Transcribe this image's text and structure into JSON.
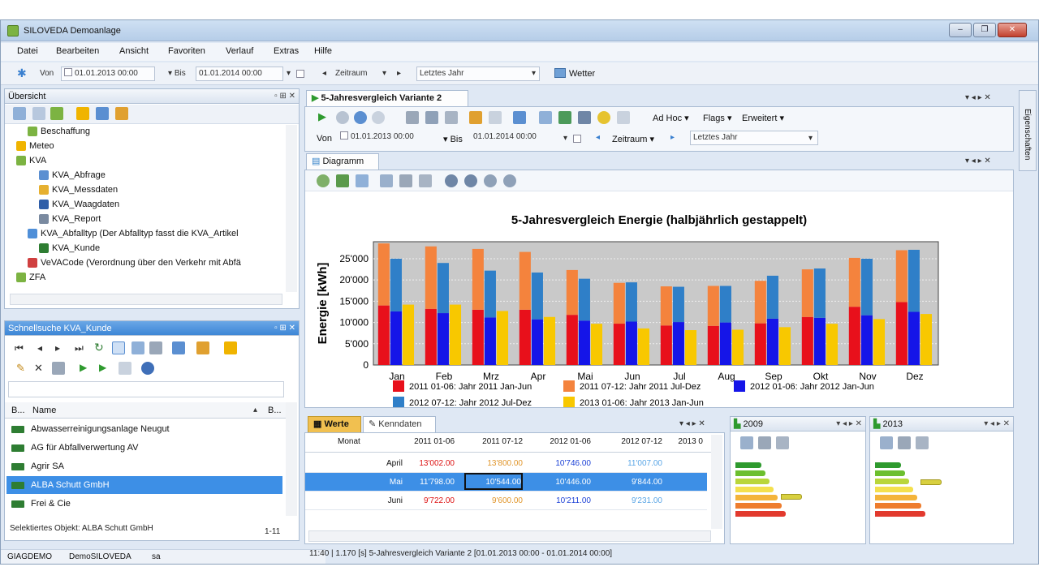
{
  "window": {
    "title": "SILOVEDA Demoanlage",
    "controls": [
      "‒",
      "❐",
      "✕"
    ]
  },
  "menu": [
    "Datei",
    "Bearbeiten",
    "Ansicht",
    "Favoriten",
    "Verlauf",
    "Extras",
    "Hilfe"
  ],
  "top_filter": {
    "von_label": "Von",
    "von_value": "01.01.2013 00:00",
    "bis_label": "Bis",
    "bis_value": "01.01.2014 00:00",
    "zeitraum_label": "Zeitraum",
    "zeitraum_value": "Letztes Jahr",
    "wetter_label": "Wetter"
  },
  "overview": {
    "title": "Übersicht",
    "tree": [
      {
        "label": "Beschaffung",
        "indent": 2,
        "icon": "folder-icon"
      },
      {
        "label": "Meteo",
        "indent": 1,
        "icon": "sun-icon"
      },
      {
        "label": "KVA",
        "indent": 1,
        "icon": "folder-icon"
      },
      {
        "label": "KVA_Abfrage",
        "indent": 3,
        "icon": "query-icon"
      },
      {
        "label": "KVA_Messdaten",
        "indent": 3,
        "icon": "database-icon"
      },
      {
        "label": "KVA_Waagdaten",
        "indent": 3,
        "icon": "scale-icon"
      },
      {
        "label": "KVA_Report",
        "indent": 3,
        "icon": "report-icon"
      },
      {
        "label": "KVA_Abfalltyp (Der Abfalltyp fasst die KVA_Artikel",
        "indent": 2,
        "icon": "tag-icon"
      },
      {
        "label": "KVA_Kunde",
        "indent": 3,
        "icon": "truck-icon"
      },
      {
        "label": "VeVACode (Verordnung über den Verkehr mit Abfä",
        "indent": 2,
        "icon": "heart-icon"
      },
      {
        "label": "ZFA",
        "indent": 1,
        "icon": "folder-icon"
      }
    ]
  },
  "quicksearch": {
    "title": "Schnellsuche KVA_Kunde",
    "col_b": "B...",
    "col_name": "Name",
    "col_b2": "B...",
    "rows": [
      "Abwasserreinigungsanlage Neugut",
      "AG für Abfallverwertung AV",
      "Agrir SA",
      "ALBA Schutt GmbH",
      "Frei & Cie"
    ],
    "selected_index": 3,
    "status_label": "Selektiertes Objekt: ALBA Schutt GmbH",
    "count": "1-11"
  },
  "footer": {
    "items": [
      "GIAGDEMO",
      "DemoSILOVEDA",
      "sa"
    ]
  },
  "report": {
    "tab_title": "5-Jahresvergleich Variante 2",
    "toolbar_labels": {
      "adhoc": "Ad Hoc",
      "flags": "Flags",
      "erweitert": "Erweitert"
    },
    "von_label": "Von",
    "von_value": "01.01.2013 00:00",
    "bis_label": "Bis",
    "bis_value": "01.01.2014 00:00",
    "zeitraum_label": "Zeitraum",
    "zeitraum_value": "Letztes Jahr",
    "diagram_tab": "Diagramm",
    "side_tab": "Eigenschaften",
    "status": "11:40 | 1.170 [s]  5-Jahresvergleich Variante 2 [01.01.2013 00:00 - 01.01.2014 00:00]"
  },
  "chart_data": {
    "type": "bar",
    "title": "5-Jahresvergleich Energie (halbjährlich gestappelt)",
    "ylabel": "Energie [kWh]",
    "xlabel": "",
    "ylim": [
      0,
      29000
    ],
    "yticks": [
      "0",
      "5'000",
      "10'000",
      "15'000",
      "20'000",
      "25'000"
    ],
    "ytick_values": [
      0,
      5000,
      10000,
      15000,
      20000,
      25000
    ],
    "categories": [
      "Jan",
      "Feb",
      "Mrz",
      "Apr",
      "Mai",
      "Jun",
      "Jul",
      "Aug",
      "Sep",
      "Okt",
      "Nov",
      "Dez"
    ],
    "stacks": [
      {
        "name": "2011",
        "bottom": {
          "name": "2011 01-06: Jahr 2011 Jan-Jun",
          "color": "#e8101b",
          "values": [
            14000,
            13200,
            13000,
            13000,
            11798,
            9722,
            9300,
            9200,
            9800,
            11300,
            13700,
            14800
          ]
        },
        "top": {
          "name": "2011 07-12: Jahr 2011 Jul-Dez",
          "color": "#f4833d",
          "values": [
            14600,
            14700,
            14300,
            13600,
            10544,
            9600,
            9200,
            9400,
            10000,
            11200,
            11500,
            12200
          ]
        }
      },
      {
        "name": "2012",
        "bottom": {
          "name": "2012 01-06: Jahr 2012 Jan-Jun",
          "color": "#1515e8",
          "values": [
            12600,
            12200,
            11200,
            10746,
            10446,
            10211,
            10100,
            10000,
            10900,
            11100,
            11700,
            12500
          ]
        },
        "top": {
          "name": "2012 07-12: Jahr 2012 Jul-Dez",
          "color": "#2f7fc8",
          "values": [
            12400,
            11800,
            11000,
            11007,
            9844,
            9231,
            8300,
            8600,
            10100,
            11600,
            13300,
            14600
          ]
        }
      },
      {
        "name": "2013",
        "bottom": {
          "name": "2013 01-06: Jahr 2013 Jan-Jun",
          "color": "#f8c800",
          "values": [
            14200,
            14200,
            12700,
            11300,
            9700,
            8600,
            8200,
            8300,
            8900,
            9700,
            10800,
            12000
          ]
        }
      }
    ],
    "legend": [
      "2011 01-06: Jahr 2011 Jan-Jun",
      "2011 07-12: Jahr 2011 Jul-Dez",
      "2012 01-06: Jahr 2012 Jan-Jun",
      "2012 07-12: Jahr 2012 Jul-Dez",
      "2013 01-06: Jahr 2013 Jan-Jun"
    ],
    "legend_placement": "bottom",
    "grid": true
  },
  "values_table": {
    "tab_werte": "Werte",
    "tab_kenndaten": "Kenndaten",
    "headers": [
      "Monat",
      "2011 01-06",
      "2011 07-12",
      "2012 01-06",
      "2012 07-12",
      "2013 0"
    ],
    "rows": [
      [
        "April",
        "13'002.00",
        "13'800.00",
        "10'746.00",
        "11'007.00"
      ],
      [
        "Mai",
        "11'798.00",
        "10'544.00",
        "10'446.00",
        "9'844.00"
      ],
      [
        "Juni",
        "9'722.00",
        "9'600.00",
        "10'211.00",
        "9'231.00"
      ]
    ],
    "selected_row": 1
  },
  "energy_panels": [
    {
      "title": "2009",
      "marker_level": 0.55
    },
    {
      "title": "2013",
      "marker_level": 0.3
    }
  ],
  "colors": {
    "accent": "#3d8fe6",
    "selection": "#3d8fe6"
  }
}
